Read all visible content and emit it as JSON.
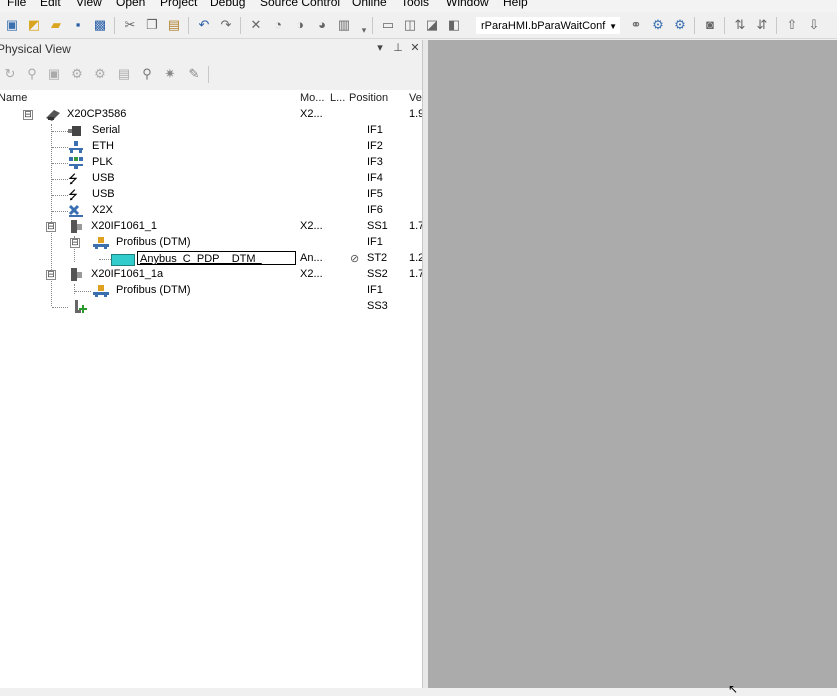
{
  "menu": {
    "items": [
      "File",
      "Edit",
      "View",
      "Open",
      "Project",
      "Debug",
      "Source Control",
      "Online",
      "Tools",
      "Window",
      "Help"
    ]
  },
  "toolbar": {
    "icons": [
      "new-project-icon",
      "open-icon",
      "open-folder-icon",
      "save-icon",
      "save-all-icon",
      "cut-icon",
      "copy-icon",
      "paste-icon",
      "undo-icon",
      "redo-icon",
      "delete-icon",
      "find-icon",
      "replace-icon",
      "replace-all-icon",
      "toolbar-overflow-icon",
      "window-icon",
      "comment-icon",
      "uncomment-icon",
      "bookmark-icon",
      "binoculars-icon",
      "watch-icon",
      "breakpoint-icon",
      "monitor-icon",
      "sort-asc-icon",
      "sort-desc-icon",
      "move-up-icon",
      "move-down-icon"
    ],
    "combo_value": "rParaHMI.bParaWaitConf"
  },
  "panel": {
    "title": "Physical View",
    "pin_glyph": "▾",
    "dock_glyph": "⊥",
    "close_glyph": "✕"
  },
  "tree": {
    "columns": {
      "name": "Name",
      "module": "Mo...",
      "location": "L...",
      "position": "Position",
      "version": "Ve"
    },
    "rows": [
      {
        "name": "X20CP3586",
        "module": "X2...",
        "position": "",
        "version": "1.9",
        "expander": "⊟"
      },
      {
        "name": "Serial",
        "module": "",
        "position": "IF1",
        "version": ""
      },
      {
        "name": "ETH",
        "module": "",
        "position": "IF2",
        "version": ""
      },
      {
        "name": "PLK",
        "module": "",
        "position": "IF3",
        "version": ""
      },
      {
        "name": "USB",
        "module": "",
        "position": "IF4",
        "version": ""
      },
      {
        "name": "USB",
        "module": "",
        "position": "IF5",
        "version": ""
      },
      {
        "name": "X2X",
        "module": "",
        "position": "IF6",
        "version": ""
      },
      {
        "name": "X20IF1061_1",
        "module": "X2...",
        "position": "SS1",
        "version": "1.7",
        "expander": "⊟"
      },
      {
        "name": "Profibus (DTM)",
        "module": "",
        "position": "IF1",
        "version": "",
        "expander": "⊟"
      },
      {
        "name": "Anybus_C_PDP__DTM_",
        "module": "An...",
        "position": "ST2",
        "version": "1.2",
        "status_glyph": "⊘"
      },
      {
        "name": "X20IF1061_1a",
        "module": "X2...",
        "position": "SS2",
        "version": "1.7",
        "expander": "⊟"
      },
      {
        "name": "Profibus (DTM)",
        "module": "",
        "position": "IF1",
        "version": ""
      },
      {
        "name": "",
        "module": "",
        "position": "SS3",
        "version": ""
      }
    ]
  },
  "colors": {
    "editor_bg": "#ababab",
    "tree_bg": "#ffffff",
    "selection_icon": "#33cccc"
  }
}
